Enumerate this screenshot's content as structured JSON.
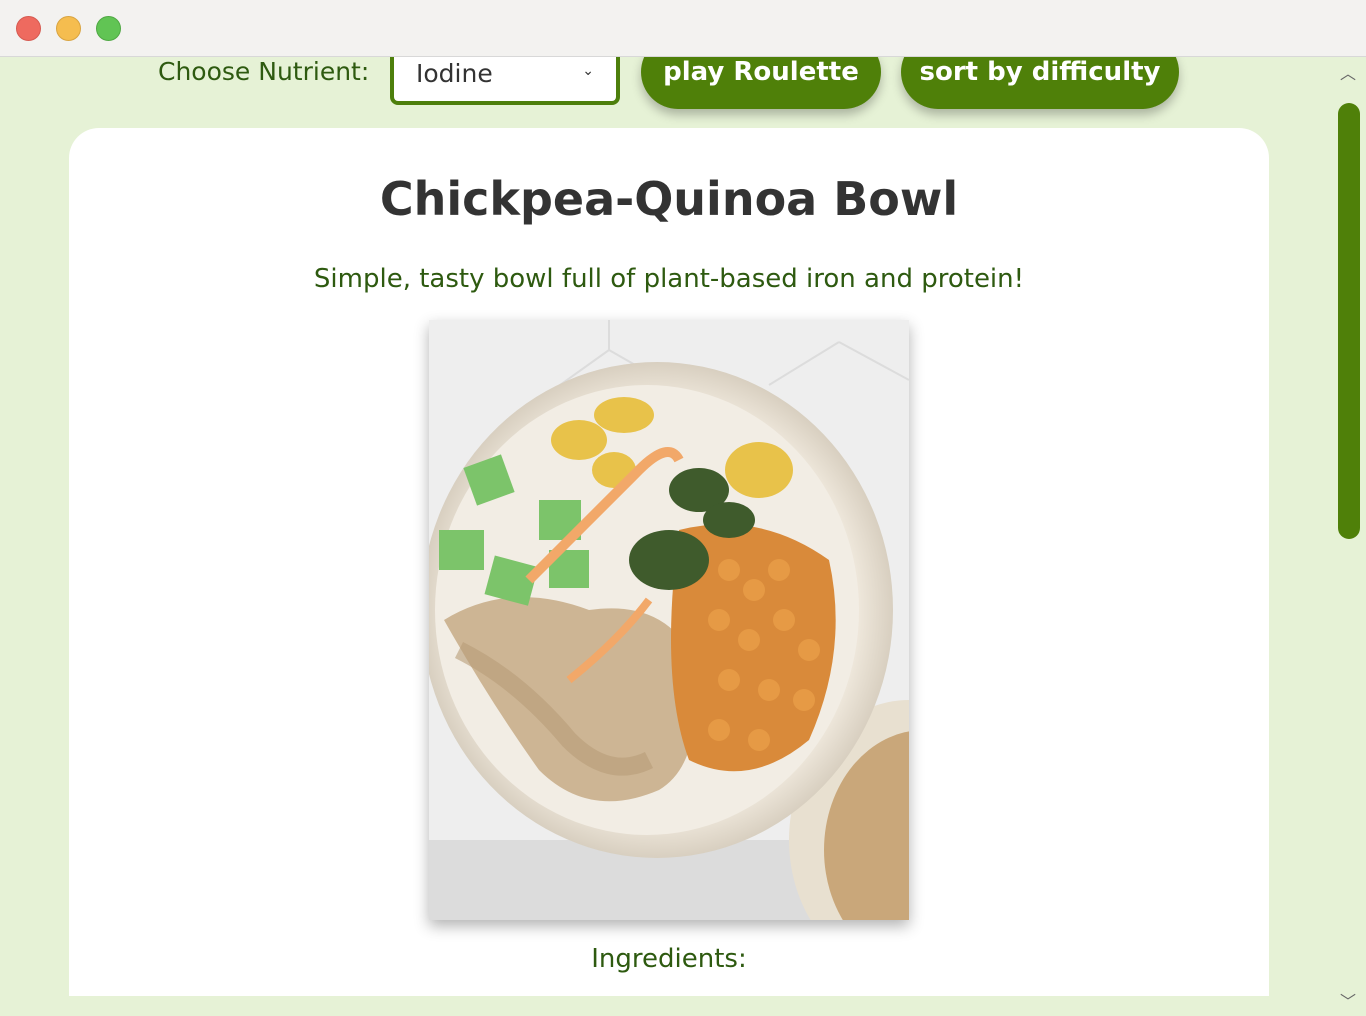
{
  "controls": {
    "nutrient_label": "Choose Nutrient:",
    "nutrient_select_value": "Iodine",
    "roulette_button": "play Roulette",
    "sort_button": "sort by difficulty"
  },
  "recipe": {
    "title": "Chickpea-Quinoa Bowl",
    "description": "Simple, tasty bowl full of plant-based iron and protein!",
    "ingredients_heading": "Ingredients:"
  },
  "colors": {
    "page_bg": "#e6f2d6",
    "accent": "#4f8009",
    "text_green": "#2e5a10"
  }
}
